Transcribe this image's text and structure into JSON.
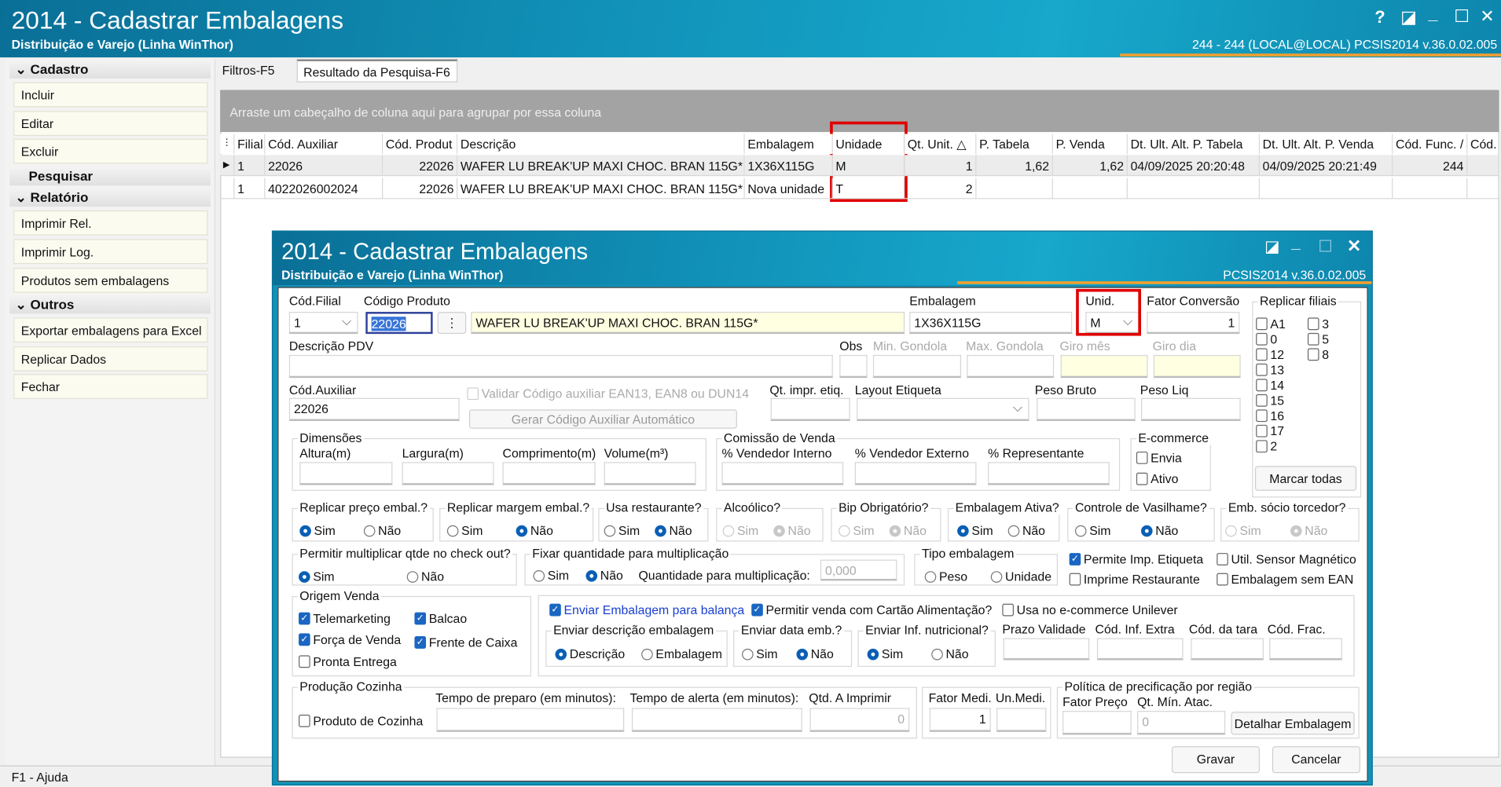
{
  "window": {
    "title": "2014 - Cadastrar Embalagens",
    "subtitle": "Distribuição e Varejo (Linha WinThor)",
    "info": "244 - 244 (LOCAL@LOCAL)   PCSIS2014  v.36.0.02.005",
    "controls": [
      "?",
      "◪",
      "_",
      "☐",
      "✕"
    ]
  },
  "sidebar": {
    "sections": [
      {
        "title": "Cadastro",
        "items": [
          "Incluir",
          "Editar",
          "Excluir"
        ]
      },
      {
        "title": "Pesquisar",
        "items": []
      },
      {
        "title": "Relatório",
        "items": [
          "Imprimir Rel.",
          "Imprimir Log.",
          "Produtos sem embalagens"
        ]
      },
      {
        "title": "Outros",
        "items": [
          "Exportar embalagens para Excel",
          "Replicar Dados",
          "Fechar"
        ]
      }
    ]
  },
  "status": "F1 - Ajuda",
  "tabs": [
    "Filtros-F5",
    "Resultado da Pesquisa-F6"
  ],
  "grid": {
    "group_hint": "Arraste um cabeçalho de coluna aqui para agrupar por essa coluna",
    "columns": [
      "Filial",
      "Cód. Auxiliar",
      "Cód. Produt",
      "Descrição",
      "Embalagem",
      "Unidade",
      "Qt. Unit. △",
      "P. Tabela",
      "P. Venda",
      "Dt. Ult. Alt. P. Tabela",
      "Dt. Ult. Alt. P. Venda",
      "Cód. Func. /",
      "Cód."
    ],
    "rows": [
      [
        "1",
        "22026",
        "22026",
        "WAFER LU BREAK'UP MAXI CHOC. BRAN 115G*",
        "1X36X115G",
        "M",
        "1",
        "1,62",
        "1,62",
        "04/09/2025 20:20:48",
        "04/09/2025 20:21:49",
        "244",
        ""
      ],
      [
        "1",
        "4022026002024",
        "22026",
        "WAFER LU BREAK'UP MAXI CHOC. BRAN 115G*",
        "Nova unidade",
        "T",
        "2",
        "",
        "",
        "",
        "",
        "",
        ""
      ]
    ]
  },
  "dialog": {
    "title": "2014 - Cadastrar Embalagens",
    "subtitle": "Distribuição e Varejo (Linha WinThor)",
    "version": "PCSIS2014  v.36.0.02.005",
    "controls": [
      "◪",
      "_",
      "☐",
      "✕"
    ],
    "labels": {
      "cod_filial": "Cód.Filial",
      "codigo_produto": "Código Produto",
      "embalagem": "Embalagem",
      "unid": "Unid.",
      "fator_conversao": "Fator Conversão",
      "replicar_filiais": "Replicar filiais",
      "descricao_pdv": "Descrição PDV",
      "obs": "Obs",
      "min_gondola": "Min. Gondola",
      "max_gondola": "Max. Gondola",
      "giro_mes": "Giro mês",
      "giro_dia": "Giro dia",
      "cod_auxiliar": "Cód.Auxiliar",
      "validar": "Validar Código auxiliar EAN13, EAN8 ou DUN14",
      "gerar": "Gerar Código Auxiliar Automático",
      "qt_impr": "Qt. impr. etiq.",
      "layout": "Layout Etiqueta",
      "peso_bruto": "Peso Bruto",
      "peso_liq": "Peso Liq",
      "dimensoes": "Dimensões",
      "altura": "Altura(m)",
      "largura": "Largura(m)",
      "comprimento": "Comprimento(m)",
      "volume": "Volume(m³)",
      "comissao": "Comissão de Venda",
      "vend_int": "% Vendedor Interno",
      "vend_ext": "% Vendedor Externo",
      "repres": "% Representante",
      "ecommerce": "E-commerce",
      "envia": "Envia",
      "ativo": "Ativo",
      "marcar_todas": "Marcar todas",
      "sim": "Sim",
      "nao": "Não",
      "permitir_mult": "Permitir multiplicar qtde no check out?",
      "fixar_qtd": "Fixar quantidade para multiplicação",
      "qtd_mult": "Quantidade para multiplicação:",
      "tipo_emb": "Tipo embalagem",
      "peso": "Peso",
      "unidade": "Unidade",
      "permite_imp": "Permite Imp. Etiqueta",
      "util_sensor": "Util. Sensor Magnético",
      "imprime_rest": "Imprime Restaurante",
      "emb_sem_ean": "Embalagem sem EAN",
      "origem_venda": "Origem Venda",
      "telemarketing": "Telemarketing",
      "balcao": "Balcao",
      "forca_venda": "Força de Venda",
      "frente_caixa": "Frente de Caixa",
      "pronta_entrega": "Pronta Entrega",
      "enviar_balanca": "Enviar Embalagem para balança",
      "cartao_alim": "Permitir venda com Cartão Alimentação?",
      "unilever": "Usa no e-commerce Unilever",
      "enviar_desc": "Enviar descrição embalagem",
      "descricao": "Descrição",
      "embalagem_opt": "Embalagem",
      "enviar_data": "Enviar data emb.?",
      "enviar_inf": "Enviar Inf. nutricional?",
      "prazo": "Prazo Validade",
      "inf_extra": "Cód. Inf. Extra",
      "tara": "Cód. da tara",
      "frac": "Cód. Frac.",
      "producao": "Produção Cozinha",
      "produto_cozinha": "Produto de Cozinha",
      "tempo_preparo": "Tempo de preparo (em minutos):",
      "tempo_alerta": "Tempo de alerta (em minutos):",
      "qtd_imprimir": "Qtd. A Imprimir",
      "fator_medi": "Fator Medi.",
      "un_medi": "Un.Medi.",
      "politica": "Política de precificação por região",
      "fator_preco": "Fator Preço",
      "qt_min": "Qt. Mín. Atac.",
      "detalhar": "Detalhar Embalagem",
      "gravar": "Gravar",
      "cancelar": "Cancelar"
    },
    "values": {
      "cod_filial": "1",
      "codigo_produto": "22026",
      "descricao": "WAFER LU BREAK'UP MAXI CHOC. BRAN 115G*",
      "embalagem": "1X36X115G",
      "unid": "M",
      "fator_conversao": "1",
      "cod_auxiliar": "22026",
      "qtd_mult": "0,000",
      "qtd_imprimir": "0",
      "fator_medi": "1",
      "qt_min": "0"
    },
    "filiais": [
      {
        "id": "A1",
        "checked": false
      },
      {
        "id": "0",
        "checked": false
      },
      {
        "id": "12",
        "checked": false
      },
      {
        "id": "13",
        "checked": false
      },
      {
        "id": "14",
        "checked": false
      },
      {
        "id": "15",
        "checked": false
      },
      {
        "id": "16",
        "checked": false
      },
      {
        "id": "17",
        "checked": false
      },
      {
        "id": "2",
        "checked": false
      },
      {
        "id": "3",
        "checked": false
      },
      {
        "id": "5",
        "checked": false
      },
      {
        "id": "8",
        "checked": false
      }
    ],
    "radio_groups": [
      {
        "label": "Replicar preço embal.?",
        "selected": "Sim",
        "enabled": true
      },
      {
        "label": "Replicar margem embal.?",
        "selected": "Não",
        "enabled": true
      },
      {
        "label": "Usa restaurante?",
        "selected": "Não",
        "enabled": true
      },
      {
        "label": "Alcoólico?",
        "selected": "Não",
        "enabled": false
      },
      {
        "label": "Bip Obrigatório?",
        "selected": "Não",
        "enabled": false
      },
      {
        "label": "Embalagem Ativa?",
        "selected": "Sim",
        "enabled": true
      },
      {
        "label": "Controle de Vasilhame?",
        "selected": "Não",
        "enabled": true
      },
      {
        "label": "Emb. sócio torcedor?",
        "selected": "Não",
        "enabled": false
      }
    ]
  },
  "colors": {
    "titlebar": "#1191b8",
    "accent_orange": "#f0a030",
    "highlight_red": "#e00000",
    "radio_blue": "#0a5fb4"
  }
}
